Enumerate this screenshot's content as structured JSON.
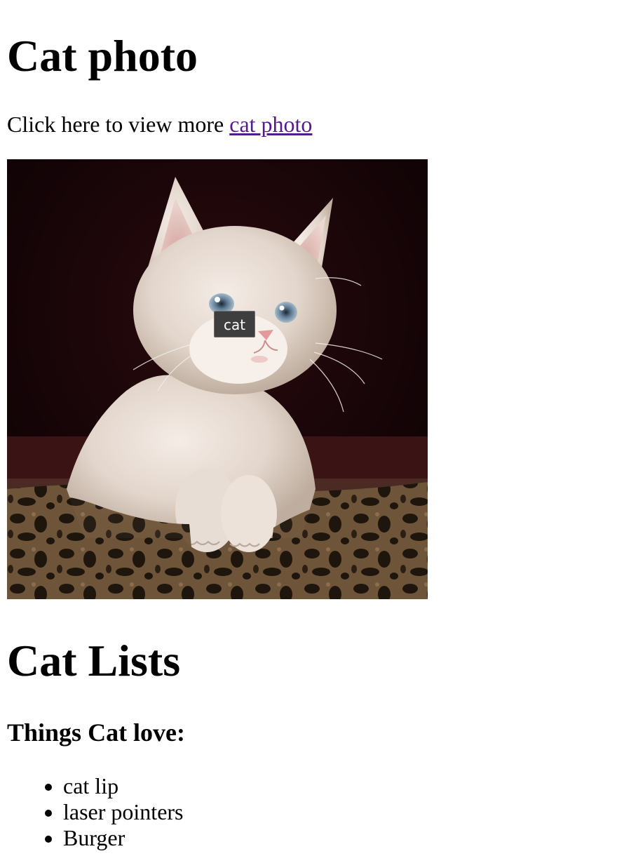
{
  "header": {
    "title": "Cat photo"
  },
  "intro": {
    "text": "Click here to view more ",
    "link_text": "cat photo"
  },
  "photo": {
    "tooltip": "cat"
  },
  "lists": {
    "title": "Cat Lists",
    "love_heading": "Things Cat love:",
    "love_items": [
      "cat lip",
      "laser pointers",
      "Burger"
    ]
  },
  "colors": {
    "link_visited": "#551a8b",
    "tooltip_bg": "#3e3e3e"
  }
}
